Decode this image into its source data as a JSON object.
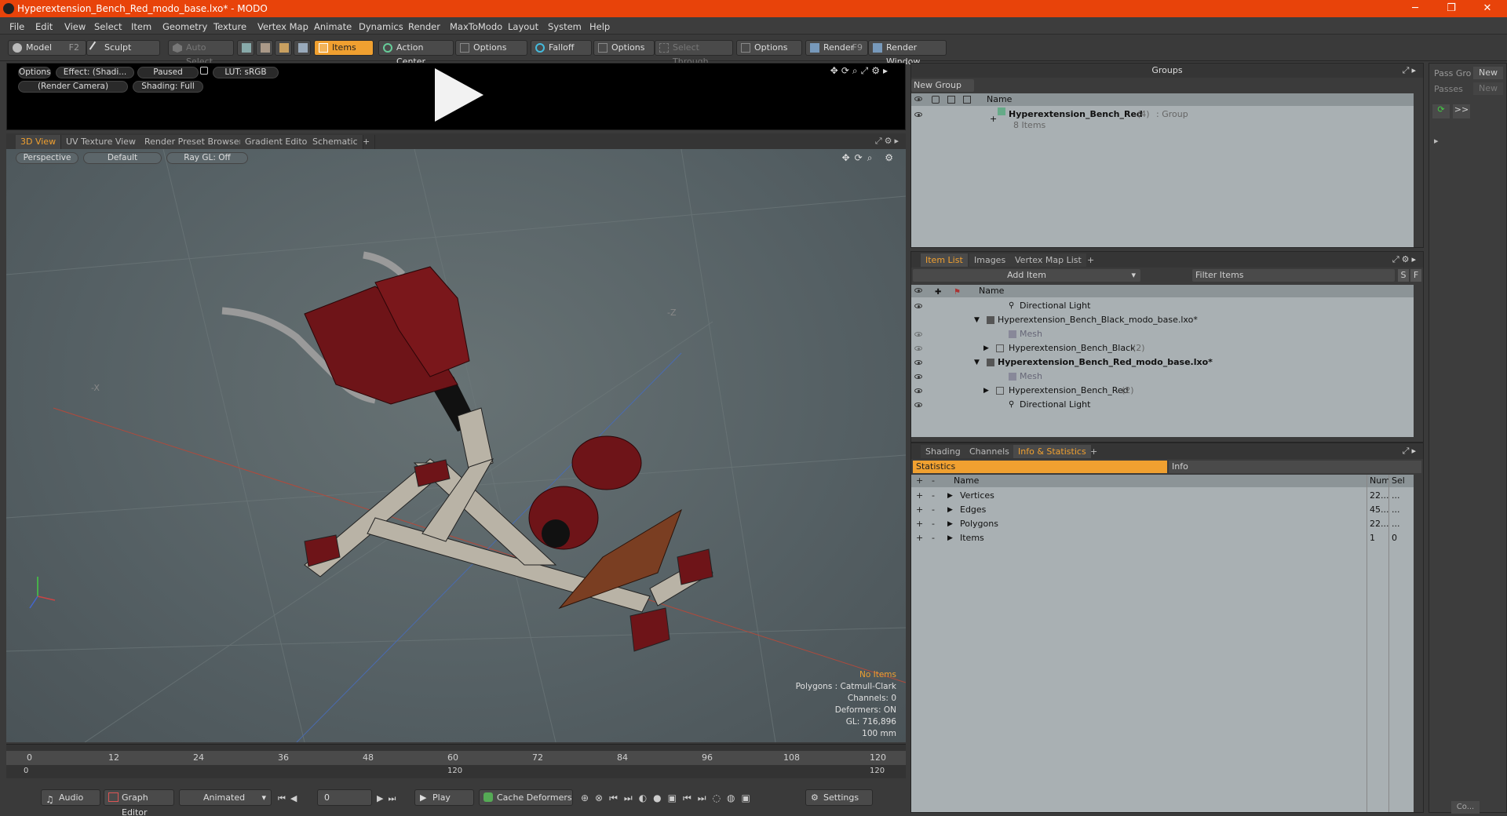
{
  "window": {
    "title": "Hyperextension_Bench_Red_modo_base.lxo* - MODO",
    "minimize": "─",
    "maximize": "❐",
    "close": "✕"
  },
  "menu": [
    "File",
    "Edit",
    "View",
    "Select",
    "Item",
    "Geometry",
    "Texture",
    "Vertex Map",
    "Animate",
    "Dynamics",
    "Render",
    "MaxToModo",
    "Layout",
    "System",
    "Help"
  ],
  "toolbar": {
    "model": "Model",
    "model_key": "F2",
    "sculpt": "Sculpt",
    "auto_select": "Auto Select",
    "items": "Items",
    "action_center": "Action Center",
    "options1": "Options",
    "falloff": "Falloff",
    "options2": "Options",
    "select_through": "Select Through",
    "options3": "Options",
    "render": "Render",
    "render_key": "F9",
    "render_window": "Render Window"
  },
  "preview": {
    "options": "Options",
    "effect": "Effect: (Shadi...",
    "paused": "Paused",
    "lut": "LUT: sRGB",
    "camera": "(Render Camera)",
    "shading": "Shading: Full"
  },
  "view_tabs": [
    "3D View",
    "UV Texture View",
    "Render Preset Browser",
    "Gradient Editor",
    "Schematic",
    "+"
  ],
  "viewport": {
    "perspective": "Perspective",
    "default": "Default",
    "raygl": "Ray GL: Off",
    "axis_label_z": "-Z",
    "axis_label_x": "-X",
    "info": {
      "no_items": "No Items",
      "polygons": "Polygons : Catmull-Clark",
      "channels": "Channels: 0",
      "deformers": "Deformers: ON",
      "gl": "GL: 716,896",
      "scale": "100 mm"
    },
    "colors": {
      "accent": "#f0a030",
      "bench_red": "#6e1418",
      "frame": "#b9b3a6",
      "wood": "#7a3e22"
    }
  },
  "timeline": {
    "ticks": [
      "0",
      "12",
      "24",
      "36",
      "48",
      "60",
      "72",
      "84",
      "96",
      "108",
      "120"
    ],
    "range": [
      "0",
      "120",
      "120"
    ]
  },
  "bottombar": {
    "audio": "Audio",
    "graph_editor": "Graph Editor",
    "animated": "Animated",
    "frame": "0",
    "play": "Play",
    "cache": "Cache Deformers",
    "settings": "Settings"
  },
  "groups": {
    "title": "Groups",
    "new_group": "New Group",
    "col_name": "Name",
    "item_name": "Hyperextension_Bench_Red",
    "item_count": "(4)",
    "item_type": ": Group",
    "item_sub": "8 Items"
  },
  "passes": {
    "pass_gro": "Pass Gro",
    "new1": "New",
    "passes": "Passes",
    "new2": "New",
    "arrows": ">>"
  },
  "itemlist": {
    "tabs": [
      "Item List",
      "Images",
      "Vertex Map List",
      "+"
    ],
    "add_item": "Add Item",
    "filter": "Filter Items",
    "s": "S",
    "f": "F",
    "col_name": "Name",
    "rows": [
      {
        "label": "Directional Light",
        "indent": 2,
        "icon": "light-icon",
        "style": "normal"
      },
      {
        "label": "Hyperextension_Bench_Black_modo_base.lxo*",
        "indent": 0,
        "icon": "scene-icon",
        "style": "normal",
        "expand": "▼"
      },
      {
        "label": "Mesh",
        "indent": 2,
        "icon": "mesh-icon",
        "style": "dim"
      },
      {
        "label": "Hyperextension_Bench_Black",
        "count": "(2)",
        "indent": 1,
        "icon": "group-icon",
        "style": "normal",
        "expand": "▶"
      },
      {
        "label": "Hyperextension_Bench_Red_modo_base.lxo*",
        "indent": 0,
        "icon": "scene-icon",
        "style": "bold",
        "expand": "▼"
      },
      {
        "label": "Mesh",
        "indent": 2,
        "icon": "mesh-icon",
        "style": "dim"
      },
      {
        "label": "Hyperextension_Bench_Red",
        "count": "(2)",
        "indent": 1,
        "icon": "group-icon",
        "style": "normal",
        "expand": "▶"
      },
      {
        "label": "Directional Light",
        "indent": 2,
        "icon": "light-icon",
        "style": "normal"
      }
    ]
  },
  "stats": {
    "tabs": [
      "Shading",
      "Channels",
      "Info & Statistics",
      "+"
    ],
    "statistics": "Statistics",
    "info": "Info",
    "cols": {
      "name": "Name",
      "num": "Num",
      "sel": "Sel"
    },
    "rows": [
      {
        "name": "Vertices",
        "num": "22...",
        "sel": "..."
      },
      {
        "name": "Edges",
        "num": "45...",
        "sel": "..."
      },
      {
        "name": "Polygons",
        "num": "22...",
        "sel": "..."
      },
      {
        "name": "Items",
        "num": "1",
        "sel": "0"
      }
    ]
  },
  "footer": {
    "co": "Co..."
  }
}
